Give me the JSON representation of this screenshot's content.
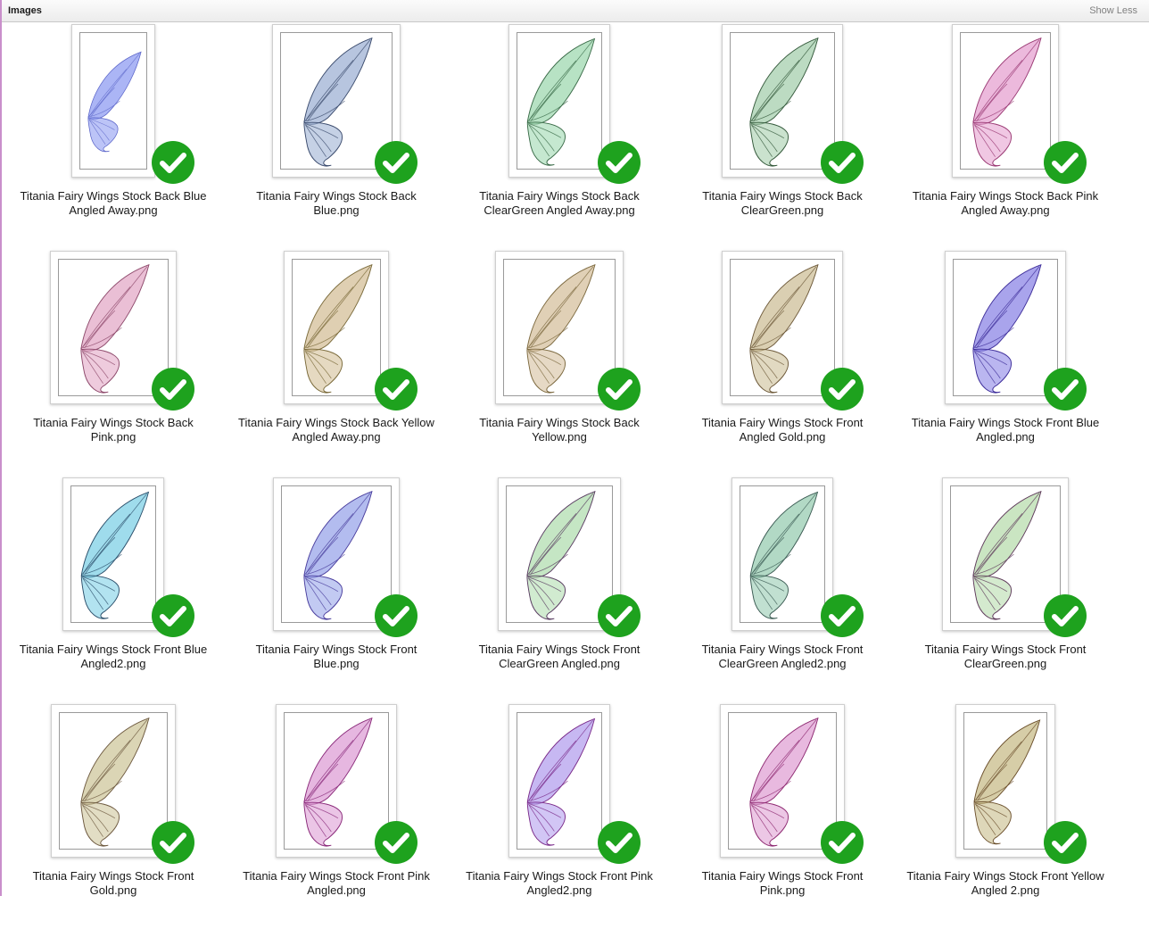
{
  "section": {
    "title": "Images",
    "toggle_label": "Show Less"
  },
  "colors": {
    "check_green": "#1ea21e",
    "header_bg": "#efefef"
  },
  "items": [
    {
      "label": "Titania Fairy Wings Stock Back Blue\nAngled Away.png",
      "tint": "#8f9cf2",
      "vein": "#5a64c8",
      "status": "check-icon"
    },
    {
      "label": "Titania Fairy Wings Stock Back\nBlue.png",
      "tint": "#9fb2d4",
      "vein": "#3c4c6e",
      "status": "check-icon"
    },
    {
      "label": "Titania Fairy Wings Stock Back\nClearGreen Angled Away.png",
      "tint": "#9fd8b0",
      "vein": "#3a6b48",
      "status": "check-icon"
    },
    {
      "label": "Titania Fairy Wings Stock Back\nClearGreen.png",
      "tint": "#a6cfae",
      "vein": "#355a3c",
      "status": "check-icon"
    },
    {
      "label": "Titania Fairy Wings Stock Back Pink\nAngled Away.png",
      "tint": "#e6a2d0",
      "vein": "#9a3a74",
      "status": "check-icon"
    },
    {
      "label": "Titania Fairy Wings Stock Back\nPink.png",
      "tint": "#e3a9c7",
      "vein": "#8e4a6c",
      "status": "check-icon"
    },
    {
      "label": "Titania Fairy Wings Stock Back Yellow\nAngled Away.png",
      "tint": "#d4bf98",
      "vein": "#7a6a3a",
      "status": "check-icon"
    },
    {
      "label": "Titania Fairy Wings Stock Back\nYellow.png",
      "tint": "#d6c09e",
      "vein": "#7d6a40",
      "status": "check-icon"
    },
    {
      "label": "Titania Fairy Wings Stock Front\nAngled Gold.png",
      "tint": "#cdbf98",
      "vein": "#6e5a3a",
      "status": "check-icon"
    },
    {
      "label": "Titania Fairy Wings Stock Front Blue\nAngled.png",
      "tint": "#8c86e6",
      "vein": "#3e2e9a",
      "status": "check-icon"
    },
    {
      "label": "Titania Fairy Wings Stock Front Blue\nAngled2.png",
      "tint": "#7fd0e6",
      "vein": "#2a4e6a",
      "status": "check-icon"
    },
    {
      "label": "Titania Fairy Wings Stock Front\nBlue.png",
      "tint": "#9aa6ea",
      "vein": "#4a3e9e",
      "status": "check-icon"
    },
    {
      "label": "Titania Fairy Wings Stock Front\nClearGreen Angled.png",
      "tint": "#b2ddb0",
      "vein": "#5a3e62",
      "status": "check-icon"
    },
    {
      "label": "Titania Fairy Wings Stock Front\nClearGreen Angled2.png",
      "tint": "#98ccb2",
      "vein": "#3a5a52",
      "status": "check-icon"
    },
    {
      "label": "Titania Fairy Wings Stock Front\nClearGreen.png",
      "tint": "#b8dcae",
      "vein": "#5e3a5a",
      "status": "check-icon"
    },
    {
      "label": "Titania Fairy Wings Stock Front\nGold.png",
      "tint": "#cfc79c",
      "vein": "#6e5a40",
      "status": "check-icon"
    },
    {
      "label": "Titania Fairy Wings Stock Front Pink\nAngled.png",
      "tint": "#de9fd6",
      "vein": "#8a2a7a",
      "status": "check-icon"
    },
    {
      "label": "Titania Fairy Wings Stock Front Pink\nAngled2.png",
      "tint": "#b4a0ee",
      "vein": "#7a2a8a",
      "status": "check-icon"
    },
    {
      "label": "Titania Fairy Wings Stock Front\nPink.png",
      "tint": "#e0a2d4",
      "vein": "#8e2a72",
      "status": "check-icon"
    },
    {
      "label": "Titania Fairy Wings Stock Front Yellow\nAngled 2.png",
      "tint": "#c8bc8a",
      "vein": "#6a4e2a",
      "status": "check-icon"
    }
  ]
}
